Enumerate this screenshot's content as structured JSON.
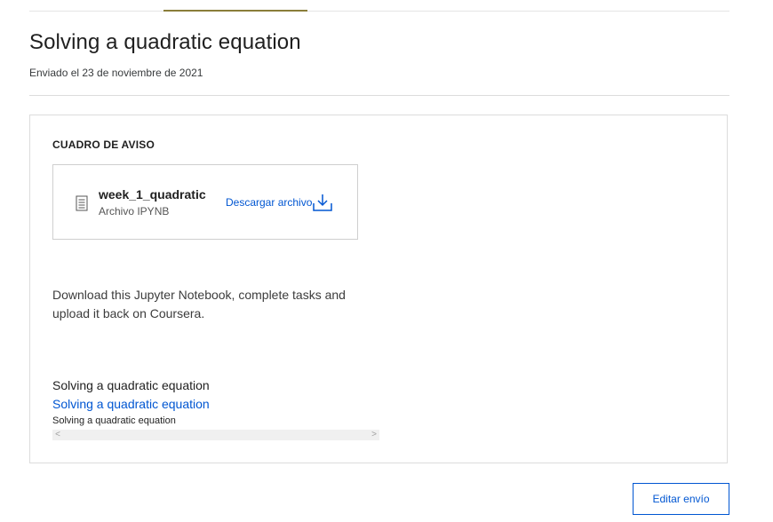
{
  "header": {
    "title": "Solving a quadratic equation",
    "submitted": "Enviado el 23 de noviembre de 2021"
  },
  "card": {
    "section_label": "CUADRO DE AVISO",
    "file": {
      "name": "week_1_quadratic",
      "type": "Archivo IPYNB",
      "download_label": "Descargar archivo",
      "icon": "document-icon",
      "download_icon": "download-icon"
    },
    "description": "Download this Jupyter Notebook, complete tasks and upload it back on Coursera.",
    "embed": {
      "line1": "Solving a quadratic equation",
      "link": "Solving a quadratic equation",
      "line3": "Solving a quadratic equation",
      "scroll_left": "<",
      "scroll_right": ">"
    }
  },
  "actions": {
    "edit_label": "Editar envío"
  },
  "colors": {
    "link": "#0056d2",
    "accent": "#8a7d3a",
    "border": "#dcdcdc"
  }
}
